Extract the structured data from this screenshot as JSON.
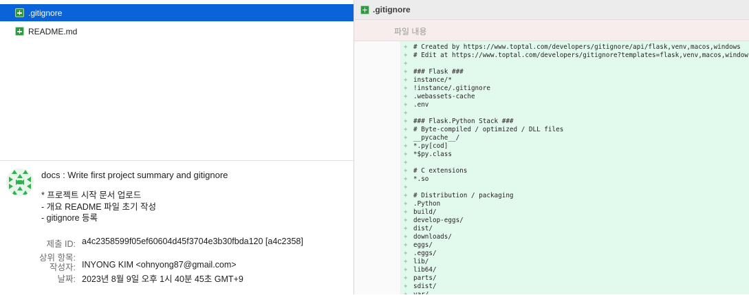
{
  "file_list": [
    {
      "name": ".gitignore",
      "selected": true,
      "status_icon": "added-file-icon"
    },
    {
      "name": "README.md",
      "selected": false,
      "status_icon": "added-file-icon"
    }
  ],
  "commit": {
    "title": "docs : Write first project summary and gitignore",
    "body": [
      "* 프로젝트 시작 문서 업로드",
      "- 개요 README 파일 초기 작성",
      "- gitignore 등록"
    ],
    "meta": [
      {
        "label": "제출 ID:",
        "value": "a4c2358599f05ef60604d45f3704e3b30fbda120 [a4c2358]"
      },
      {
        "label": "상위 항목:",
        "value": ""
      },
      {
        "label": "작성자:",
        "value": "INYONG KIM <ohnyong87@gmail.com>"
      },
      {
        "label": "날짜:",
        "value": "2023년 8월 9일 오후 1시 40분 45초 GMT+9"
      }
    ]
  },
  "diff": {
    "file_name": ".gitignore",
    "content_label": "파일 내용",
    "added_prefix": "+",
    "lines": [
      "# Created by https://www.toptal.com/developers/gitignore/api/flask,venv,macos,windows",
      "# Edit at https://www.toptal.com/developers/gitignore?templates=flask,venv,macos,windows",
      "",
      "### Flask ###",
      "instance/*",
      "!instance/.gitignore",
      ".webassets-cache",
      ".env",
      "",
      "### Flask.Python Stack ###",
      "# Byte-compiled / optimized / DLL files",
      "__pycache__/",
      "*.py[cod]",
      "*$py.class",
      "",
      "# C extensions",
      "*.so",
      "",
      "# Distribution / packaging",
      ".Python",
      "build/",
      "develop-eggs/",
      "dist/",
      "downloads/",
      "eggs/",
      ".eggs/",
      "lib/",
      "lib64/",
      "parts/",
      "sdist/",
      "var/"
    ]
  },
  "colors": {
    "selection": "#0a63d8",
    "added_icon": "#2a9d3c",
    "added_line_bg": "#e2f9ee",
    "content_label_bg": "#f7eded"
  }
}
